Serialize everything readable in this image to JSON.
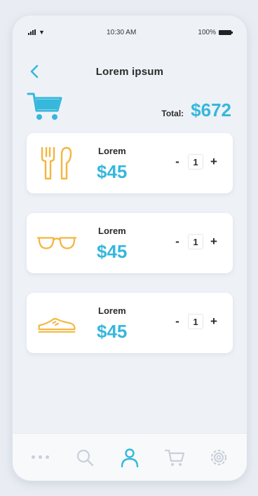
{
  "status_bar": {
    "time": "10:30 AM",
    "battery": "100%"
  },
  "header": {
    "title": "Lorem ipsum"
  },
  "summary": {
    "total_label": "Total:",
    "total_value": "$672"
  },
  "items": [
    {
      "name": "Lorem",
      "price": "$45",
      "qty": "1",
      "icon": "cutlery-icon"
    },
    {
      "name": "Lorem",
      "price": "$45",
      "qty": "1",
      "icon": "glasses-icon"
    },
    {
      "name": "Lorem",
      "price": "$45",
      "qty": "1",
      "icon": "sneaker-icon"
    }
  ],
  "controls": {
    "minus": "-",
    "plus": "+"
  },
  "tabbar": {
    "tabs": [
      "more-icon",
      "search-icon",
      "profile-icon",
      "cart-icon",
      "settings-icon"
    ],
    "active": "profile-icon"
  },
  "colors": {
    "accent": "#36b7dc",
    "item_icon": "#f4b63f",
    "inactive": "#c9d0da",
    "text": "#2b2b2b"
  }
}
